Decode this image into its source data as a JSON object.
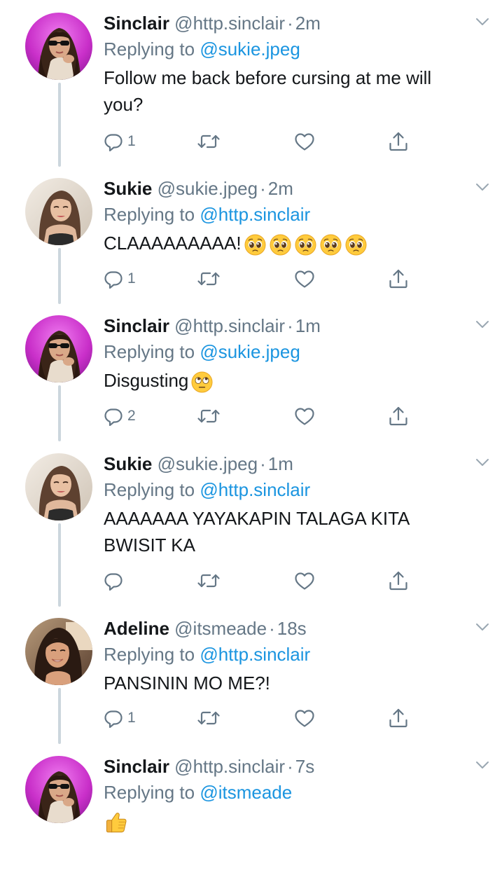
{
  "tweets": [
    {
      "name": "Sinclair",
      "handle": "@http.sinclair",
      "separator": "·",
      "time": "2m",
      "replying_prefix": "Replying to",
      "replying_to": "@sukie.jpeg",
      "text": "Follow me back before cursing at me will you?",
      "emoji": [],
      "reply_count": "1",
      "avatar": "avatar-sinclair"
    },
    {
      "name": "Sukie",
      "handle": "@sukie.jpeg",
      "separator": "·",
      "time": "2m",
      "replying_prefix": "Replying to",
      "replying_to": "@http.sinclair",
      "text": "CLAAAAAAAAA!",
      "emoji": [
        "pleading-face-emoji",
        "pleading-face-emoji",
        "pleading-face-emoji",
        "pleading-face-emoji",
        "pleading-face-emoji"
      ],
      "reply_count": "1",
      "avatar": "avatar-sukie"
    },
    {
      "name": "Sinclair",
      "handle": "@http.sinclair",
      "separator": "·",
      "time": "1m",
      "replying_prefix": "Replying to",
      "replying_to": "@sukie.jpeg",
      "text": "Disgusting",
      "emoji": [
        "eye-roll-emoji"
      ],
      "reply_count": "2",
      "avatar": "avatar-sinclair"
    },
    {
      "name": "Sukie",
      "handle": "@sukie.jpeg",
      "separator": "·",
      "time": "1m",
      "replying_prefix": "Replying to",
      "replying_to": "@http.sinclair",
      "text": "AAAAAAA YAYAKAPIN TALAGA KITA BWISIT KA",
      "emoji": [],
      "reply_count": "",
      "avatar": "avatar-sukie"
    },
    {
      "name": "Adeline",
      "handle": "@itsmeade",
      "separator": "·",
      "time": "18s",
      "replying_prefix": "Replying to",
      "replying_to": "@http.sinclair",
      "text": "PANSININ MO ME?!",
      "emoji": [],
      "reply_count": "1",
      "avatar": "avatar-adeline"
    },
    {
      "name": "Sinclair",
      "handle": "@http.sinclair",
      "separator": "·",
      "time": "7s",
      "replying_prefix": "Replying to",
      "replying_to": "@itsmeade",
      "text": "",
      "emoji": [
        "thumbs-up-emoji"
      ],
      "reply_count": null,
      "avatar": "avatar-sinclair"
    }
  ],
  "icons": {
    "reply": "reply-icon",
    "retweet": "retweet-icon",
    "like": "heart-icon",
    "share": "share-icon",
    "more": "chevron-down-icon"
  },
  "colors": {
    "text": "#14171a",
    "secondary": "#657786",
    "link": "#1b95e0",
    "thread_line": "#ccd6dd",
    "icon": "#657786"
  }
}
